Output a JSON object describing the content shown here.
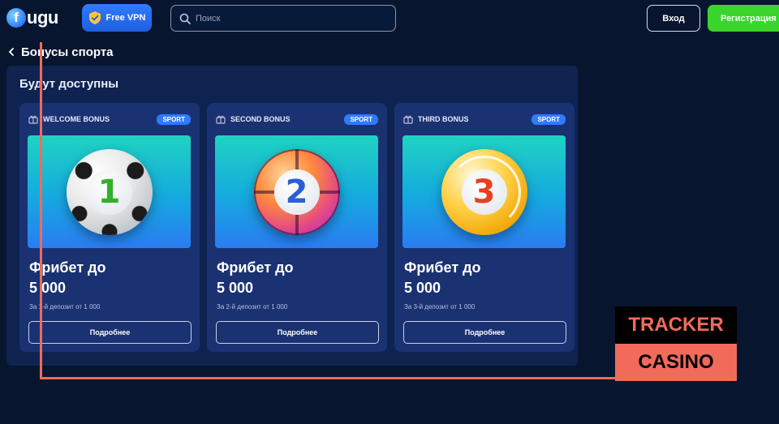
{
  "header": {
    "logo_letter": "f",
    "logo_text": "ugu",
    "vpn_label": "Free VPN",
    "search_placeholder": "Поиск",
    "login_label": "Вход",
    "register_label": "Регистрация"
  },
  "page": {
    "title": "Бонусы спорта",
    "section_title": "Будут доступны"
  },
  "cards": [
    {
      "name": "WELCOME BONUS",
      "badge": "SPORT",
      "number": "1",
      "title_line1": "Фрибет до",
      "title_line2": "5 000",
      "subtitle": "За 1-й депозит от 1 000",
      "button": "Подробнее",
      "ball": "soccer-ball-icon",
      "number_color": "#2fb12b"
    },
    {
      "name": "SECOND BONUS",
      "badge": "SPORT",
      "number": "2",
      "title_line1": "Фрибет до",
      "title_line2": "5 000",
      "subtitle": "За 2-й депозит от 1 000",
      "button": "Подробнее",
      "ball": "basketball-icon",
      "number_color": "#2a5fd8"
    },
    {
      "name": "THIRD BONUS",
      "badge": "SPORT",
      "number": "3",
      "title_line1": "Фрибет до",
      "title_line2": "5 000",
      "subtitle": "За 3-й депозит от 1 000",
      "button": "Подробнее",
      "ball": "volleyball-icon",
      "number_color": "#e8401f"
    }
  ],
  "overlay": {
    "tracker": "TRACKER",
    "casino": "CASINO"
  },
  "colors": {
    "background": "#08152f",
    "panel": "#0f2350",
    "card": "#1a3272",
    "accent_blue": "#2f7bff",
    "accent_green": "#39d52c",
    "overlay_red": "#f26a5a"
  }
}
